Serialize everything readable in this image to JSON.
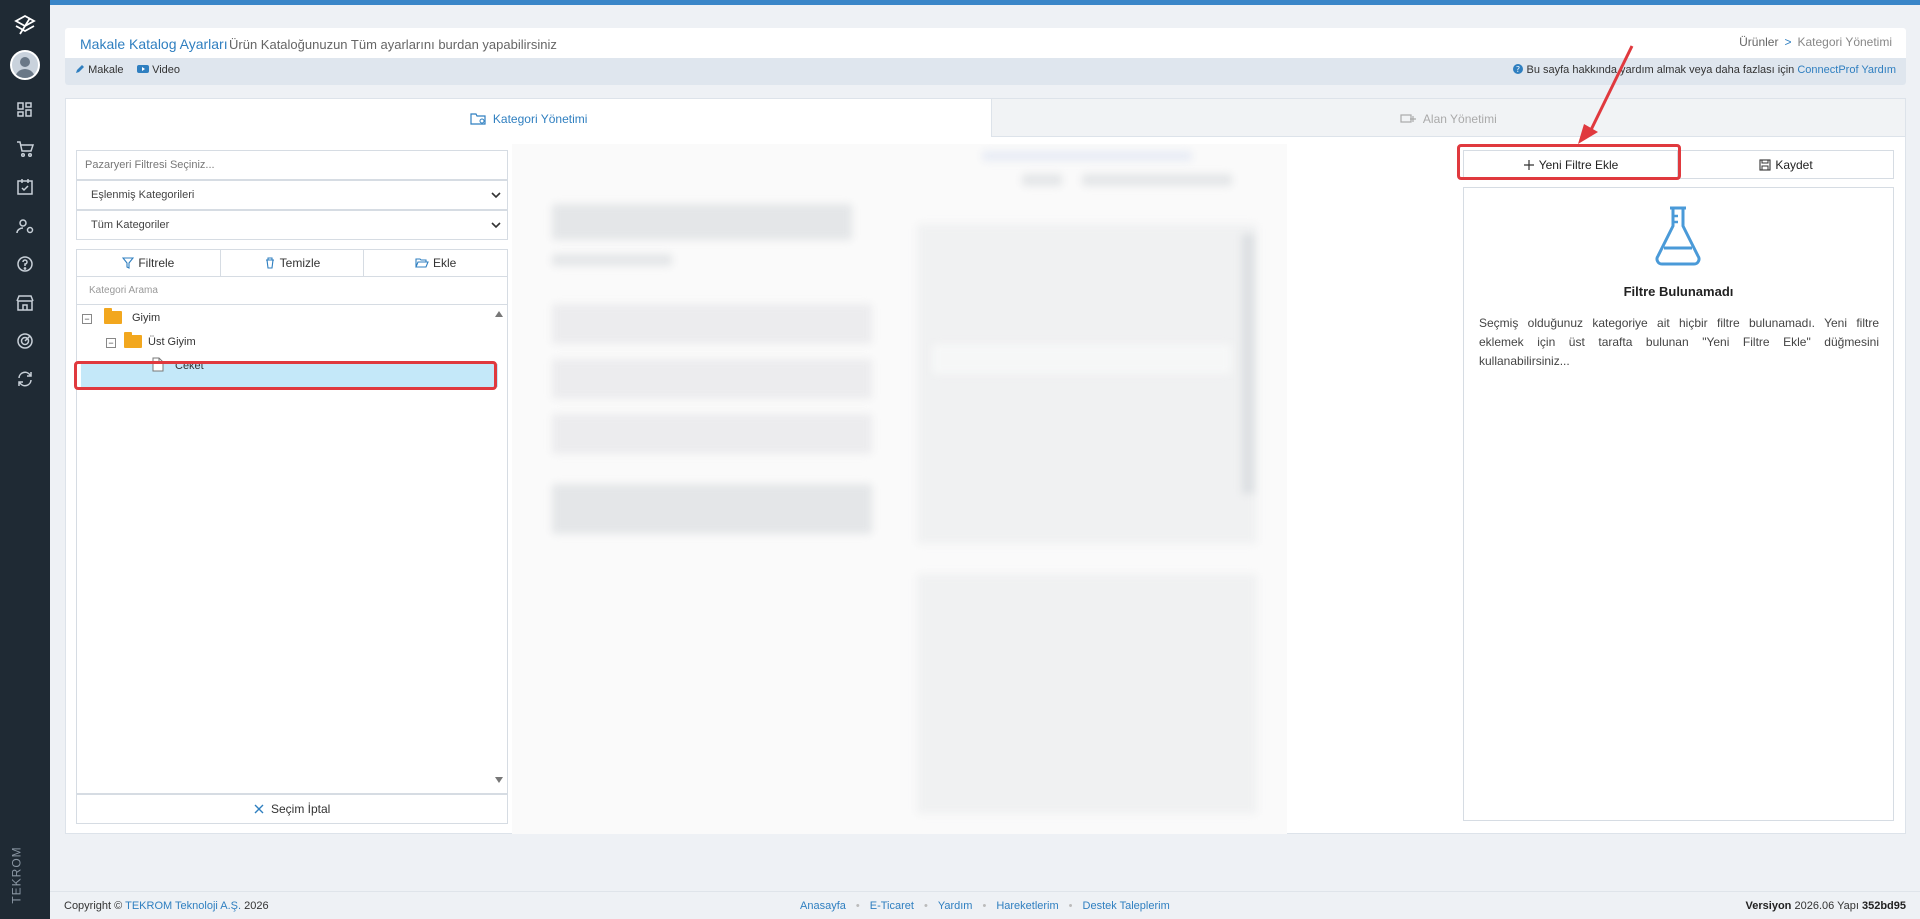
{
  "sidebar": {
    "brand": "TEKROM",
    "icons": [
      "logo-icon",
      "dashboard-icon",
      "cart-icon",
      "calendar-check-icon",
      "user-settings-icon",
      "help-icon",
      "store-icon",
      "radar-icon",
      "sync-icon"
    ]
  },
  "header": {
    "title": "Makale Katalog Ayarları",
    "description": "Ürün Kataloğunuzun Tüm ayarlarını burdan yapabilirsiniz",
    "breadcrumb": [
      "Ürünler",
      "Kategori Yönetimi"
    ],
    "breadcrumb_sep": ">",
    "links": {
      "article": "Makale",
      "video": "Video"
    },
    "help_text": "Bu sayfa hakkında yardım almak veya daha fazlası için",
    "help_link": "ConnectProf Yardım"
  },
  "tabs": {
    "active": "Kategori Yönetimi",
    "inactive": "Alan Yönetimi"
  },
  "left": {
    "marketplace_filter_placeholder": "Pazaryeri Filtresi Seçiniz...",
    "matched_select": "Eşlenmiş Kategorileri",
    "all_select": "Tüm Kategoriler",
    "buttons": {
      "filter": "Filtrele",
      "clear": "Temizle",
      "add": "Ekle"
    },
    "search_placeholder": "Kategori Arama",
    "tree": [
      {
        "label": "Giyim",
        "toggle": "⊟"
      },
      {
        "label": "Üst Giyim",
        "toggle": "⊟"
      },
      {
        "label": "Ceket"
      }
    ],
    "cancel": "Seçim İptal"
  },
  "right": {
    "new_filter": "Yeni Filtre Ekle",
    "save": "Kaydet",
    "empty_title": "Filtre Bulunamadı",
    "empty_text": "Seçmiş olduğunuz kategoriye ait hiçbir filtre bulunamadı. Yeni filtre eklemek için üst tarafta bulunan \"Yeni Filtre Ekle\" düğmesini kullanabilirsiniz..."
  },
  "footer": {
    "copyright_prefix": "Copyright ©",
    "company": "TEKROM Teknoloji A.Ş.",
    "year": "2026",
    "links": [
      "Anasayfa",
      "E-Ticaret",
      "Yardım",
      "Hareketlerim",
      "Destek Taleplerim"
    ],
    "version_label": "Versiyon",
    "version": "2026.06 Yapı",
    "build": "352bd95"
  },
  "colors": {
    "accent": "#2f7fc0",
    "highlight": "#e0393e",
    "sidebar": "#1f2a34",
    "selected": "#c4e8f9"
  }
}
